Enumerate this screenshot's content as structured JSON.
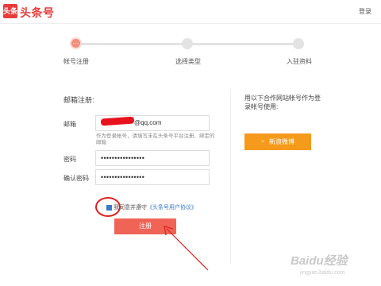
{
  "header": {
    "logo_badge": "头条",
    "logo_text": "头条号",
    "login": "登录"
  },
  "steps": [
    {
      "label": "帐号注册",
      "active": true
    },
    {
      "label": "选择类型",
      "active": false
    },
    {
      "label": "入驻资料",
      "active": false
    }
  ],
  "step1_dots": "···",
  "form": {
    "section_title": "邮箱注册:",
    "email_label": "邮箱",
    "email_value": "@qq.com",
    "email_hint": "作为登录帐号，请填写未在头条号平台注册、绑定的邮箱",
    "password_label": "密码",
    "password_value": "••••••••••••••••",
    "confirm_label": "确认密码",
    "confirm_value": "••••••••••••••••",
    "agree_prefix": "我同意并遵守",
    "agree_link": "《头条号用户协议》",
    "register_label": "注册"
  },
  "partner": {
    "text": "用以下合作网站帐号作为登录帐号使用:",
    "weibo_label": "新浪微博"
  },
  "watermark": {
    "brand": "Baidu经验",
    "sub": "jingyan.baidu.com"
  },
  "colors": {
    "brand_red": "#e83c3c",
    "register_button": "#ef6456",
    "weibo_orange": "#f59a1b",
    "link_blue": "#3a78c8",
    "annotation_red": "#e02020"
  }
}
